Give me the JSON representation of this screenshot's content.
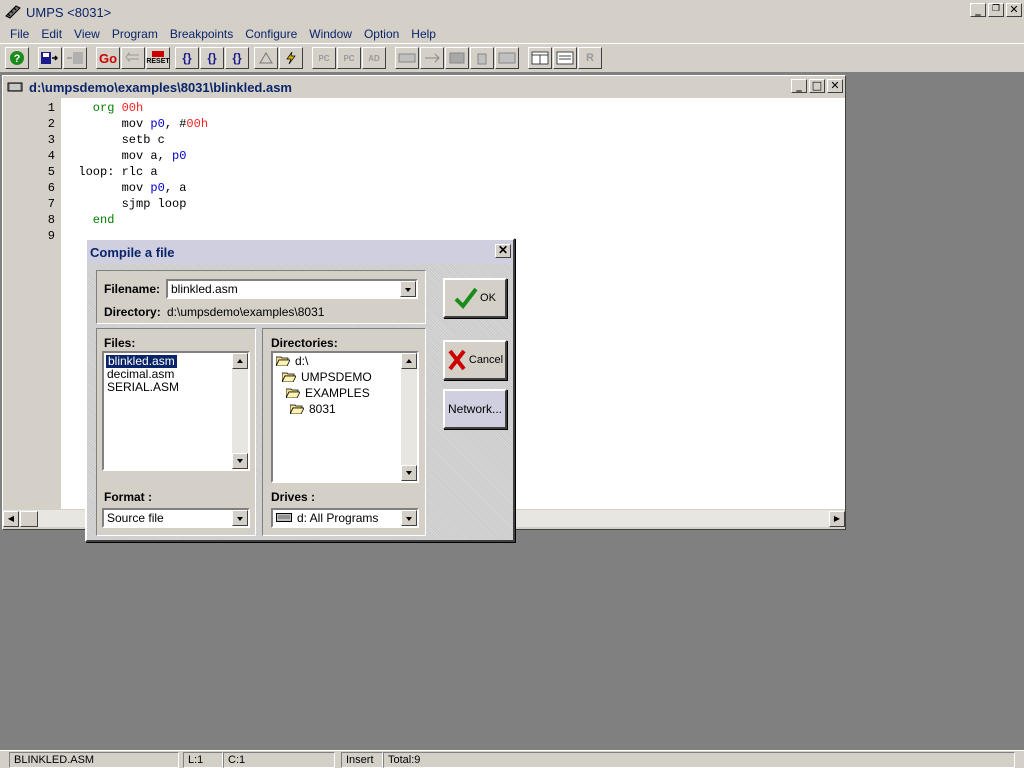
{
  "app": {
    "title": "UMPS <8031>"
  },
  "menu": [
    "File",
    "Edit",
    "View",
    "Program",
    "Breakpoints",
    "Configure",
    "Window",
    "Option",
    "Help"
  ],
  "toolbar": {
    "go_label": "Go",
    "reset_label": "RESET",
    "step_into": "{}",
    "step_over": "{}",
    "step_out": "{}",
    "pc_label": "PC",
    "pc2_label": "PC",
    "ad_label": "AD",
    "r_label": "R"
  },
  "editor": {
    "path": "d:\\umpsdemo\\examples\\8031\\blinkled.asm",
    "line_numbers": [
      "1",
      "2",
      "3",
      "4",
      "5",
      "6",
      "7",
      "8",
      "9"
    ],
    "lines": [
      {
        "indent": "    ",
        "label": "",
        "tokens": [
          {
            "t": "org",
            "c": "kw-green"
          },
          {
            "t": " ",
            "c": "tok-plain"
          },
          {
            "t": "00h",
            "c": "tok-red"
          }
        ]
      },
      {
        "indent": "        ",
        "label": "",
        "tokens": [
          {
            "t": "mov ",
            "c": "tok-plain"
          },
          {
            "t": "p0",
            "c": "tok-blue"
          },
          {
            "t": ", #",
            "c": "tok-plain"
          },
          {
            "t": "00h",
            "c": "tok-red"
          }
        ]
      },
      {
        "indent": "        ",
        "label": "",
        "tokens": [
          {
            "t": "setb c",
            "c": "tok-plain"
          }
        ]
      },
      {
        "indent": "        ",
        "label": "",
        "tokens": [
          {
            "t": "mov a, ",
            "c": "tok-plain"
          },
          {
            "t": "p0",
            "c": "tok-blue"
          }
        ]
      },
      {
        "indent": "  ",
        "label": "",
        "tokens": [
          {
            "t": "loop: rlc a",
            "c": "tok-plain"
          }
        ]
      },
      {
        "indent": "        ",
        "label": "",
        "tokens": [
          {
            "t": "mov ",
            "c": "tok-plain"
          },
          {
            "t": "p0",
            "c": "tok-blue"
          },
          {
            "t": ", a",
            "c": "tok-plain"
          }
        ]
      },
      {
        "indent": "        ",
        "label": "",
        "tokens": [
          {
            "t": "sjmp loop",
            "c": "tok-plain"
          }
        ]
      },
      {
        "indent": "    ",
        "label": "",
        "tokens": [
          {
            "t": "end",
            "c": "kw-green"
          }
        ]
      },
      {
        "indent": "",
        "label": "",
        "tokens": []
      }
    ]
  },
  "dialog": {
    "title": "Compile a file",
    "filename_label": "Filename:",
    "filename_value": "blinkled.asm",
    "directory_label": "Directory:",
    "directory_value": "d:\\umpsdemo\\examples\\8031",
    "files_label": "Files:",
    "files": [
      "blinkled.asm",
      "decimal.asm",
      "SERIAL.ASM"
    ],
    "selected_file": "blinkled.asm",
    "directories_label": "Directories:",
    "directories": [
      "d:\\",
      "UMPSDEMO",
      "EXAMPLES",
      "8031"
    ],
    "format_label": "Format :",
    "format_value": "Source file",
    "drives_label": "Drives :",
    "drives_value": "d: All Programs",
    "ok_label": "OK",
    "cancel_label": "Cancel",
    "network_label": "Network..."
  },
  "status": {
    "file": "BLINKLED.ASM",
    "line": "L:1",
    "col": "C:1",
    "mode": "Insert",
    "total": "Total:9"
  },
  "colors": {
    "title_text": "#0a246a",
    "green_ok": "#1a8c1a",
    "red_cancel": "#cc0000",
    "keyword": "#008000",
    "number": "#ff2020",
    "register": "#0000cc"
  }
}
